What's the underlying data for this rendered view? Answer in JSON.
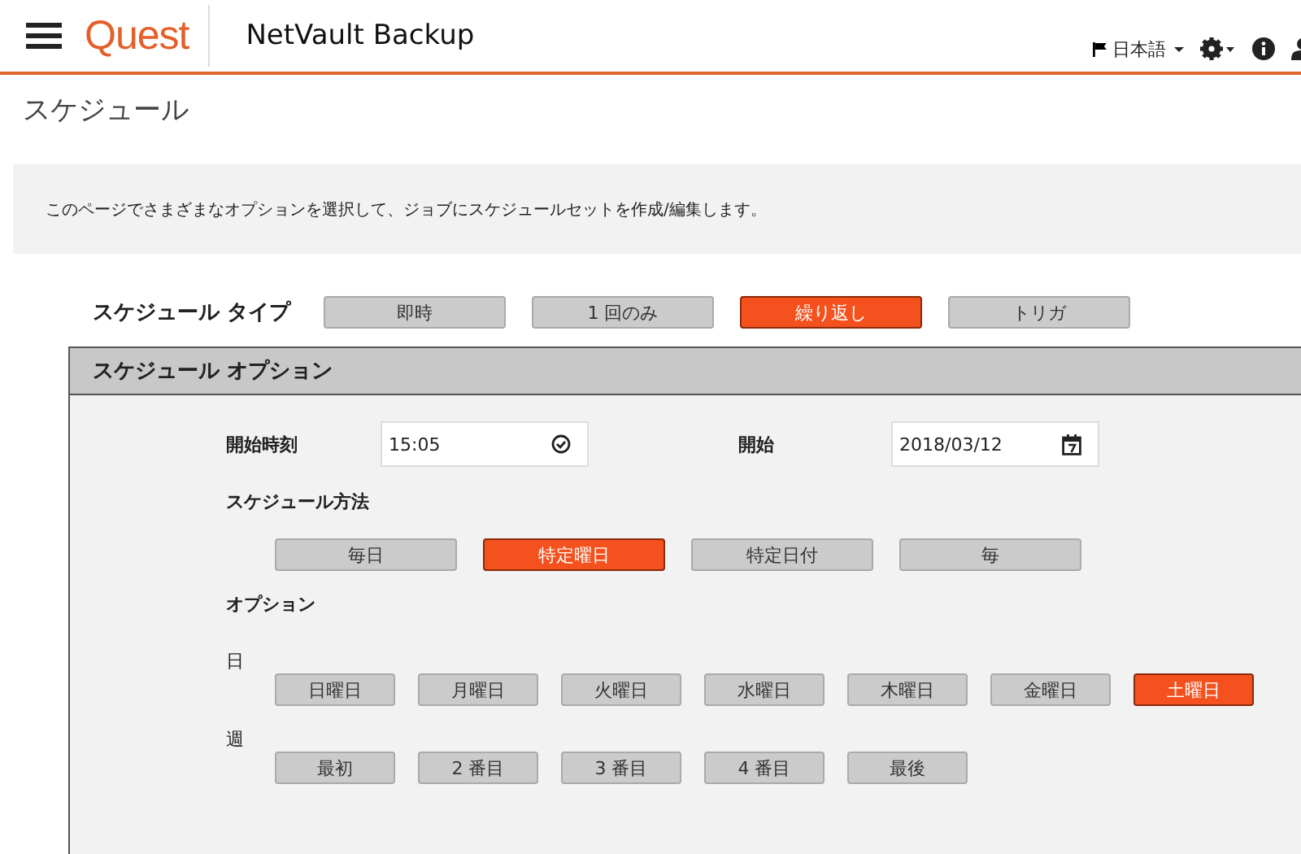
{
  "header": {
    "logo": "Quest",
    "product": "NetVault Backup",
    "language": "日本語"
  },
  "page_title": "スケジュール",
  "description": "このページでさまざまなオプションを選択して、ジョブにスケジュールセットを作成/編集します。",
  "schedule_type": {
    "label": "スケジュール タイプ",
    "options": [
      {
        "label": "即時",
        "selected": false
      },
      {
        "label": "1 回のみ",
        "selected": false
      },
      {
        "label": "繰り返し",
        "selected": true
      },
      {
        "label": "トリガ",
        "selected": false
      }
    ]
  },
  "schedule_options": {
    "title": "スケジュール オプション",
    "start_time": {
      "label": "開始時刻",
      "value": "15:05"
    },
    "start_date": {
      "label": "開始",
      "value": "2018/03/12"
    },
    "method": {
      "label": "スケジュール方法",
      "options": [
        {
          "label": "毎日",
          "selected": false
        },
        {
          "label": "特定曜日",
          "selected": true
        },
        {
          "label": "特定日付",
          "selected": false
        },
        {
          "label": "毎",
          "selected": false
        }
      ]
    },
    "options_label": "オプション",
    "days": {
      "label": "日",
      "options": [
        {
          "label": "日曜日",
          "selected": false
        },
        {
          "label": "月曜日",
          "selected": false
        },
        {
          "label": "火曜日",
          "selected": false
        },
        {
          "label": "水曜日",
          "selected": false
        },
        {
          "label": "木曜日",
          "selected": false
        },
        {
          "label": "金曜日",
          "selected": false
        },
        {
          "label": "土曜日",
          "selected": true
        }
      ]
    },
    "weeks": {
      "label": "週",
      "options": [
        {
          "label": "最初",
          "selected": false
        },
        {
          "label": "2 番目",
          "selected": false
        },
        {
          "label": "3 番目",
          "selected": false
        },
        {
          "label": "4 番目",
          "selected": false
        },
        {
          "label": "最後",
          "selected": false
        }
      ]
    }
  }
}
